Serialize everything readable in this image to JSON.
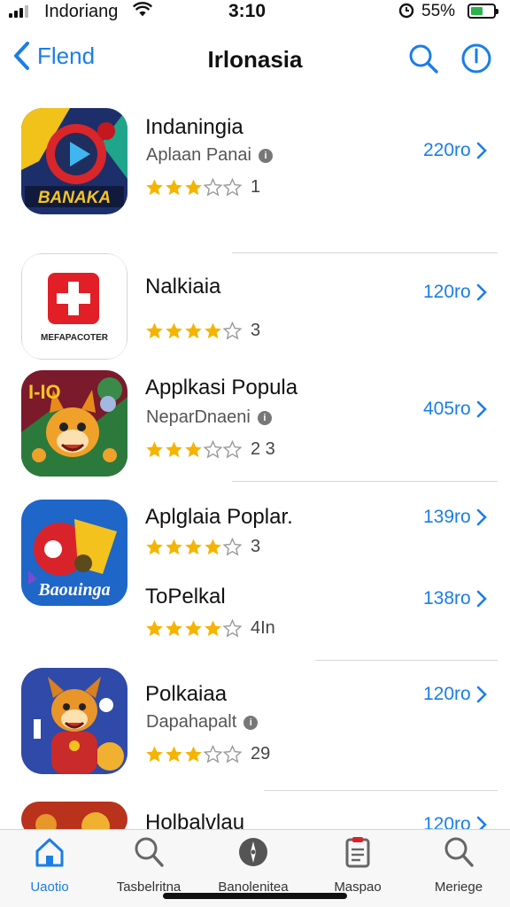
{
  "status_bar": {
    "carrier": "Indoriang",
    "time": "3:10",
    "battery_percent": "55%",
    "battery_level": 0.55
  },
  "nav": {
    "back_label": "Flend",
    "title": "Irlonasia"
  },
  "apps": [
    {
      "name": "Indaningia",
      "developer": "Aplaan Panai",
      "rating": 3,
      "rating_count": "1",
      "size": "220ro",
      "icon": "banner-play-game-icon",
      "icon_text": "BANAKA"
    },
    {
      "name": "Nalkiaia",
      "developer": "",
      "rating": 4,
      "rating_count": "3",
      "size": "120ro",
      "icon": "red-plus-app-icon",
      "icon_text": "MEFAPACOTER"
    },
    {
      "name": "Applkasi Popula",
      "developer": "NeparDnaeni",
      "rating": 3,
      "rating_count": "2 3",
      "size": "405ro",
      "icon": "cartoon-fox-game-icon",
      "icon_text": "I-IO"
    },
    {
      "name": "Aplglaia Poplar.",
      "developer": "",
      "rating": 4,
      "rating_count": "3",
      "size": "139ro",
      "icon": "blue-brand-app-icon",
      "icon_text": "Baouinga"
    },
    {
      "name": "ToPelkal",
      "developer": "",
      "rating": 4,
      "rating_count": "4In",
      "size": "138ro"
    },
    {
      "name": "Polkaiaa",
      "developer": "Dapahapalt",
      "rating": 3,
      "rating_count": "29",
      "size": "120ro",
      "icon": "cartoon-fox-character-icon"
    },
    {
      "name": "Holbalvlau",
      "size": "120ro",
      "icon": "partial-game-icon"
    }
  ],
  "tabs": [
    {
      "label": "Uaotio",
      "icon": "home-icon",
      "active": true
    },
    {
      "label": "Tasbelritna",
      "icon": "search-icon",
      "active": false
    },
    {
      "label": "Banolenitea",
      "icon": "compass-icon",
      "active": false
    },
    {
      "label": "Maspao",
      "icon": "clipboard-icon",
      "active": false
    },
    {
      "label": "Meriege",
      "icon": "search-icon",
      "active": false
    }
  ],
  "colors": {
    "accent": "#1a7ee6",
    "star": "#f5b400",
    "battery": "#2bb24c"
  }
}
